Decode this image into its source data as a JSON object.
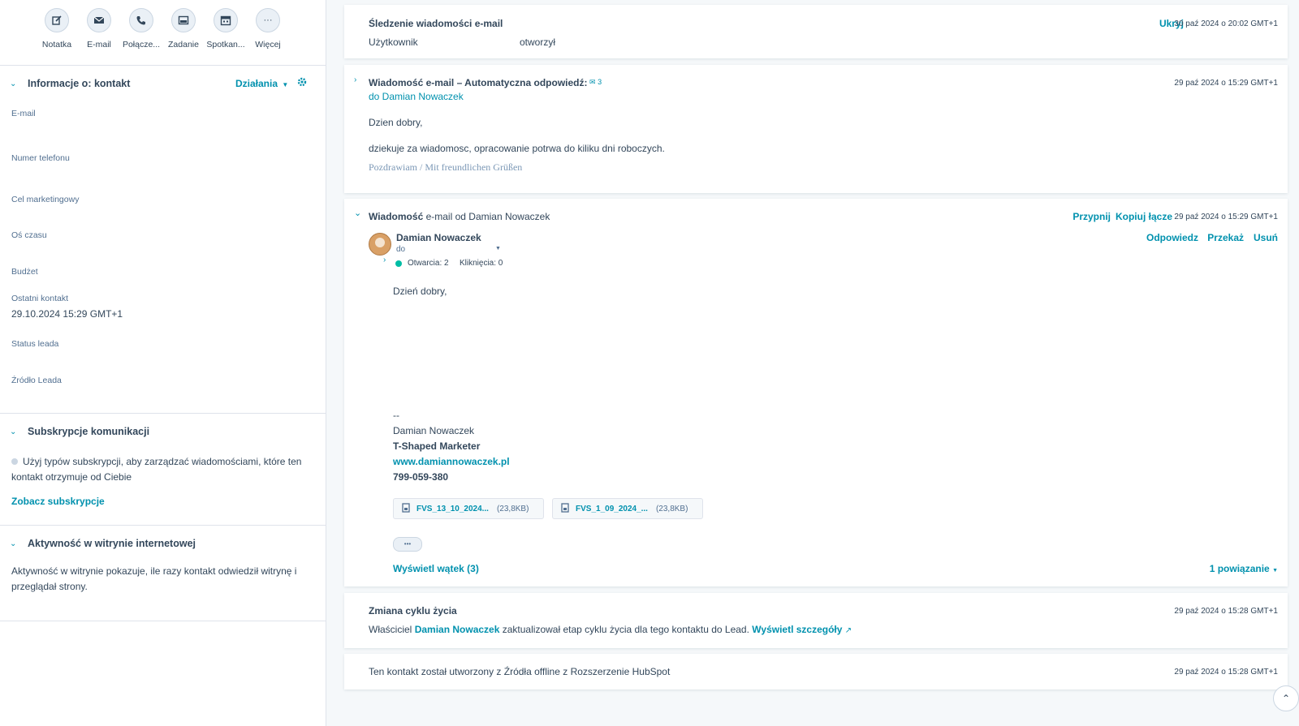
{
  "actions": [
    {
      "label": "Notatka",
      "icon": "edit-icon"
    },
    {
      "label": "E-mail",
      "icon": "envelope-icon"
    },
    {
      "label": "Połącze...",
      "icon": "phone-icon"
    },
    {
      "label": "Zadanie",
      "icon": "task-icon"
    },
    {
      "label": "Spotkan...",
      "icon": "calendar-icon"
    },
    {
      "label": "Więcej",
      "icon": "more-icon"
    }
  ],
  "contact_info": {
    "title": "Informacje o: kontakt",
    "actions_label": "Działania",
    "fields": [
      {
        "label": "E-mail",
        "value": ""
      },
      {
        "label": "Numer telefonu",
        "value": ""
      },
      {
        "label": "Cel marketingowy",
        "value": ""
      },
      {
        "label": "Oś czasu",
        "value": ""
      },
      {
        "label": "Budżet",
        "value": ""
      },
      {
        "label": "Ostatni kontakt",
        "value": "29.10.2024 15:29 GMT+1"
      },
      {
        "label": "Status leada",
        "value": ""
      },
      {
        "label": "Źródło Leada",
        "value": ""
      }
    ]
  },
  "subscriptions": {
    "title": "Subskrypcje komunikacji",
    "text1": "Użyj typów subskrypcji, aby zarządzać wiadomościami, które ten",
    "text2": "kontakt otrzymuje od Ciebie",
    "link": "Zobacz subskrypcje"
  },
  "web_activity": {
    "title": "Aktywność w witrynie internetowej",
    "text1": "Aktywność w witrynie pokazuje, ile razy kontakt odwiedził witrynę i",
    "text2": "przeglądał strony."
  },
  "feed": {
    "tracking": {
      "title": "Śledzenie wiadomości e-mail",
      "user": "Użytkownik",
      "action": "otworzył",
      "hide": "Ukryj",
      "timestamp": "30 paź 2024 o 20:02 GMT+1"
    },
    "auto_reply": {
      "title": "Wiadomość e-mail – Automatyczna odpowiedź:",
      "count": "3",
      "to": "do Damian Nowaczek",
      "timestamp": "29 paź 2024 o 15:29 GMT+1",
      "line1": "Dzien dobry,",
      "line2": "dziekuje za wiadomosc, opracowanie potrwa do kiliku dni roboczych.",
      "line3": "Pozdrawiam / Mit freundlichen Grüßen"
    },
    "email": {
      "title_bold": "Wiadomość",
      "title_rest": "e-mail od Damian Nowaczek",
      "pin": "Przypnij",
      "copy_link": "Kopiuj łącze",
      "timestamp": "29 paź 2024 o 15:29 GMT+1",
      "sender": "Damian Nowaczek",
      "to": "do",
      "reply": "Odpowiedz",
      "forward": "Przekaż",
      "delete": "Usuń",
      "opens": "Otwarcia: 2",
      "clicks": "Kliknięcia: 0",
      "greeting": "Dzień dobry,",
      "sig_dash": "--",
      "sig_name": "Damian Nowaczek",
      "sig_title": "T-Shaped Marketer",
      "sig_web": "www.damiannowaczek.pl",
      "sig_phone": "799-059-380",
      "attachments": [
        {
          "name": "FVS_13_10_2024...",
          "size": "(23,8KB)"
        },
        {
          "name": "FVS_1_09_2024_...",
          "size": "(23,8KB)"
        }
      ],
      "more": "•••",
      "thread": "Wyświetl wątek (3)",
      "associations": "1 powiązanie"
    },
    "lifecycle": {
      "title": "Zmiana cyklu życia",
      "timestamp": "29 paź 2024 o 15:28 GMT+1",
      "t1": "Właściciel",
      "owner": "Damian Nowaczek",
      "t2": "zaktualizował etap cyklu życia dla tego kontaktu do Lead.",
      "details": "Wyświetl szczegóły"
    },
    "created": {
      "text": "Ten kontakt został utworzony z Źródła offline z Rozszerzenie HubSpot",
      "timestamp": "29 paź 2024 o 15:28 GMT+1"
    }
  },
  "colors": {
    "accent": "#0091ae",
    "text": "#33475b",
    "border": "#dfe3eb",
    "bg": "#f5f8fa",
    "open_dot": "#00bda5"
  }
}
